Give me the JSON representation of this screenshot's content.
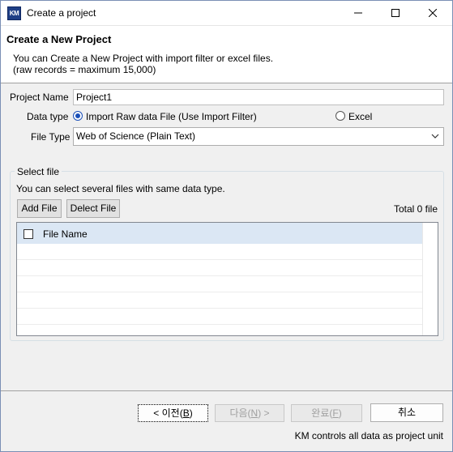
{
  "window": {
    "title": "Create a project",
    "icon_text": "KM",
    "controls": [
      "minimize-icon",
      "maximize-icon",
      "close-icon"
    ]
  },
  "header": {
    "title": "Create a New Project",
    "desc_line1": "You can Create a New Project with import filter or excel files.",
    "desc_line2": "(raw records = maximum 15,000)"
  },
  "form": {
    "project_name_label": "Project Name",
    "project_name_value": "Project1",
    "data_type_label": "Data type",
    "data_type_options": [
      {
        "label": "Import Raw data File (Use Import Filter)",
        "selected": true
      },
      {
        "label": "Excel",
        "selected": false
      }
    ],
    "file_type_label": "File Type",
    "file_type_value": "Web of Science (Plain Text)"
  },
  "select_file": {
    "legend": "Select file",
    "hint": "You can select several files with same data type.",
    "add_file_label": "Add File",
    "delete_file_label": "Delect File",
    "total_label": "Total 0 file",
    "table": {
      "columns": [
        "File Name"
      ],
      "rows": []
    }
  },
  "footer": {
    "back_label": "< 이전(",
    "back_key": "B",
    "next_label": "다음(",
    "next_key": "N",
    "next_suffix": ") >",
    "finish_label": "완료(",
    "finish_key": "F",
    "cancel_label": "취소",
    "note": "KM controls all data as project unit"
  }
}
